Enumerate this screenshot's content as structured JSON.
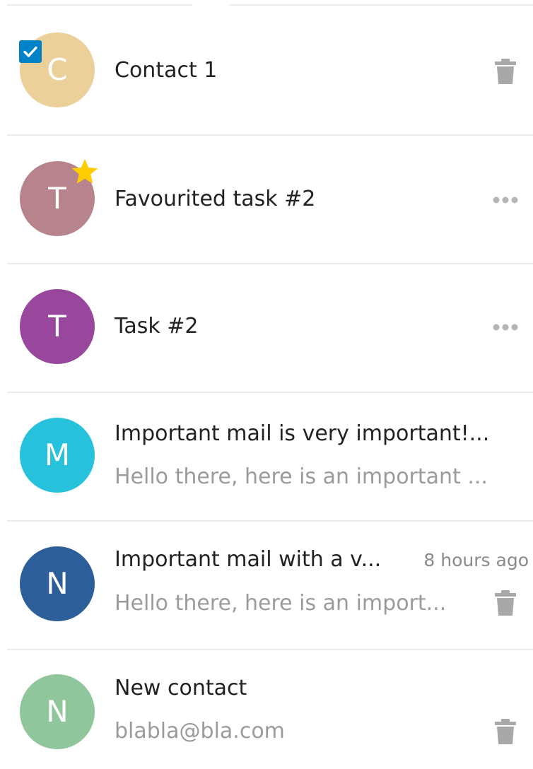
{
  "items": [
    {
      "initial": "C",
      "avatar_color": "#ecd09a",
      "title": "Contact 1",
      "selected": true,
      "favorite": false,
      "action_icon": "trash-icon"
    },
    {
      "initial": "T",
      "avatar_color": "#b7848d",
      "title": "Favourited task #2",
      "selected": false,
      "favorite": true,
      "action_icon": "more-icon"
    },
    {
      "initial": "T",
      "avatar_color": "#98479c",
      "title": "Task #2",
      "selected": false,
      "favorite": false,
      "action_icon": "more-icon"
    },
    {
      "initial": "M",
      "avatar_color": "#26c1da",
      "title": "Important mail is very important!...",
      "subtitle": "Hello there, here is an important ...",
      "selected": false,
      "favorite": false
    },
    {
      "initial": "N",
      "avatar_color": "#2c5f9a",
      "title": "Important mail with a v...",
      "time": "8 hours ago",
      "subtitle": "Hello there, here is an import...",
      "selected": false,
      "favorite": false,
      "action_icon": "trash-icon"
    },
    {
      "initial": "N",
      "avatar_color": "#8fc69b",
      "title": "New contact",
      "subtitle": "blabla@bla.com",
      "selected": false,
      "favorite": false,
      "action_icon": "trash-icon"
    }
  ]
}
